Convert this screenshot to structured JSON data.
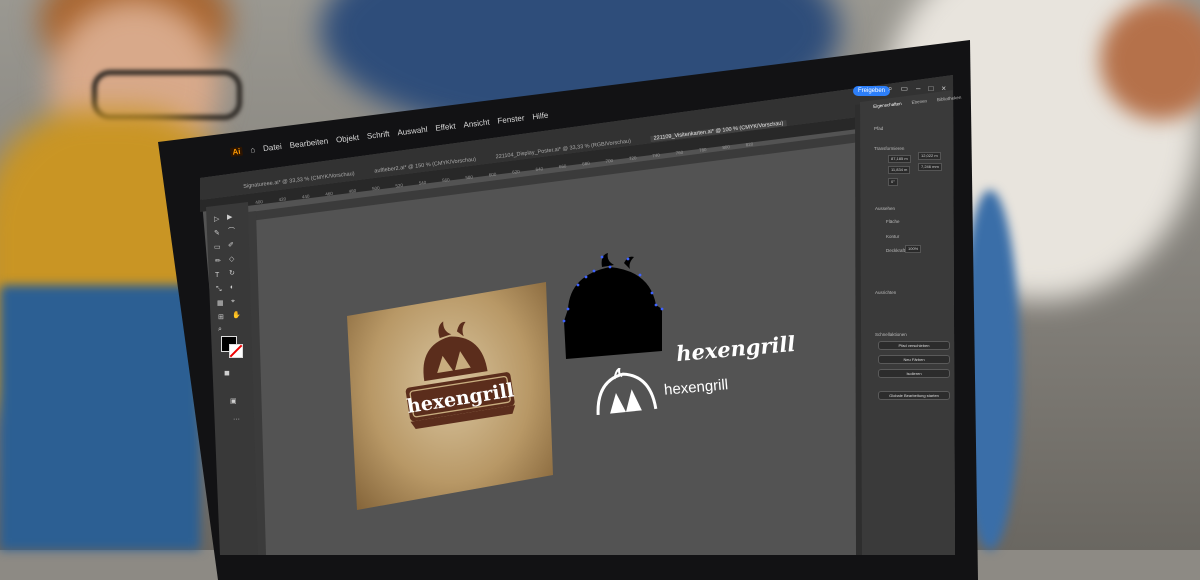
{
  "menu": {
    "app_badge": "Ai",
    "items": [
      "Datei",
      "Bearbeiten",
      "Objekt",
      "Schrift",
      "Auswahl",
      "Effekt",
      "Ansicht",
      "Fenster",
      "Hilfe"
    ]
  },
  "tabs": [
    {
      "label": "Signatureee.ai* @ 33,33 % (CMYK/Vorschau)",
      "active": false
    },
    {
      "label": "auftleber2.ai* @ 150 % (CMYK/Vorschau)",
      "active": false
    },
    {
      "label": "221104_Display_Poster.ai* @ 33,33 % (RGB/Vorschau)",
      "active": false
    },
    {
      "label": "221109_Visitenkarten.ai* @ 100 % (CMYK/Vorschau)",
      "active": true
    }
  ],
  "ruler_ticks": [
    "400",
    "420",
    "440",
    "460",
    "480",
    "500",
    "520",
    "540",
    "560",
    "580",
    "600",
    "620",
    "640",
    "660",
    "680",
    "700",
    "720",
    "740",
    "760",
    "780",
    "800",
    "820"
  ],
  "header": {
    "share_label": "Freigeben"
  },
  "panel": {
    "tabs": [
      "Eigenschaften",
      "Ebenen",
      "Bibliotheken"
    ],
    "sections": {
      "path": "Pfad",
      "transform": "Transformieren",
      "x_value": "87,185 m",
      "w_value": "12,022 m",
      "y_value": "11,834 m",
      "h_value": "7,246 mm",
      "angle_value": "0°",
      "appearance": "Aussehen",
      "fill": "Fläche",
      "stroke": "Kontur",
      "opacity": "Deckkraft",
      "opacity_value": "100%",
      "align": "Ausrichten",
      "quick_actions": "Schnellaktionen",
      "btn_offset": "Pfad verschieben",
      "btn_recolor": "Neu Färben",
      "btn_expand": "Isolieren",
      "btn_texture": "Globale Bearbeitung starten"
    }
  },
  "artwork": {
    "wordmark": "hexengrill",
    "brand_color": "#5b2d1c",
    "parchment_color": "#c8ad7f"
  }
}
